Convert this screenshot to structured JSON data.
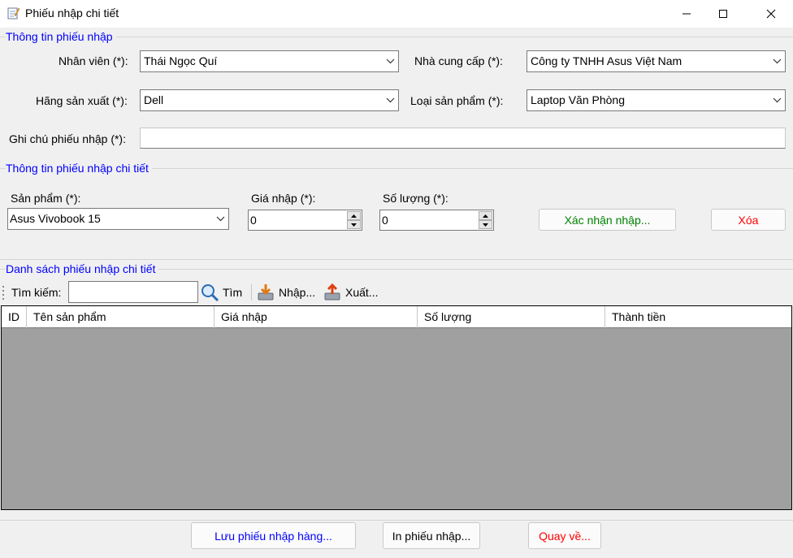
{
  "window": {
    "title": "Phiếu nhập chi tiết"
  },
  "receipt_info": {
    "group_title": "Thông tin phiếu nhập",
    "employee_label": "Nhân viên (*):",
    "employee_value": "Thái Ngọc Quí",
    "supplier_label": "Nhà cung cấp (*):",
    "supplier_value": "Công ty TNHH Asus Việt Nam",
    "manufacturer_label": "Hãng sản xuất (*):",
    "manufacturer_value": "Dell",
    "product_type_label": "Loại sản phẩm (*):",
    "product_type_value": "Laptop Văn Phòng",
    "note_label": "Ghi chú phiếu nhập (*):",
    "note_value": ""
  },
  "detail_info": {
    "group_title": "Thông tin phiếu nhập chi tiết",
    "product_label": "Sản phẩm (*):",
    "product_value": "Asus Vivobook 15",
    "price_label": "Giá nhập (*):",
    "price_value": "0",
    "quantity_label": "Số lượng (*):",
    "quantity_value": "0",
    "confirm_button": "Xác nhận nhập...",
    "delete_button": "Xóa"
  },
  "detail_list": {
    "group_title": "Danh sách phiếu nhập chi tiết",
    "search_label": "Tìm kiếm:",
    "search_value": "",
    "search_button": "Tìm",
    "import_button": "Nhập...",
    "export_button": "Xuất...",
    "columns": [
      "ID",
      "Tên sản phẩm",
      "Giá nhập",
      "Số lượng",
      "Thành tiền"
    ]
  },
  "footer": {
    "save_button": "Lưu phiếu nhập hàng...",
    "print_button": "In phiếu nhập...",
    "back_button": "Quay về..."
  },
  "colors": {
    "group_title": "#0000ff",
    "confirm_text": "#008000",
    "delete_text": "#ff0000",
    "save_text": "#0000ff",
    "back_text": "#ff0000",
    "grid_background": "#a0a0a0"
  }
}
